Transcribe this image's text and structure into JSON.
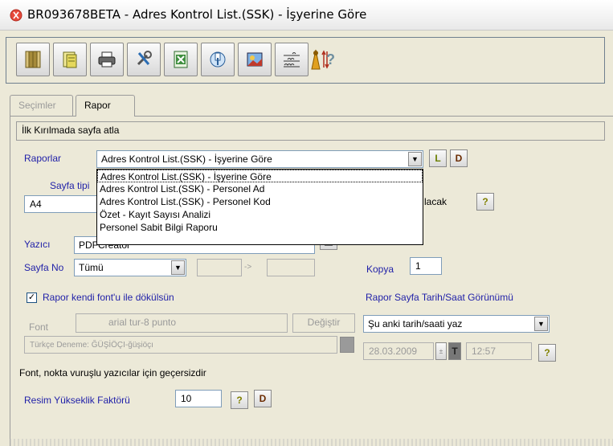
{
  "window": {
    "title": "BR093678BETA - Adres Kontrol List.(SSK) - İşyerine Göre"
  },
  "toolbar": {
    "buttons": [
      "book-icon",
      "document-icon",
      "printer-icon",
      "tools-icon",
      "excel-icon",
      "export-icon",
      "image-icon",
      "signatures-icon",
      "figure-icon",
      "sort-icon"
    ],
    "help_label": "?"
  },
  "tabs": [
    {
      "label": "Seçimler",
      "active": false
    },
    {
      "label": "Rapor",
      "active": true
    }
  ],
  "form": {
    "first_break_label": "İlk Kırılmada sayfa atla",
    "reports_label": "Raporlar",
    "reports_value": "Adres Kontrol List.(SSK) - İşyerine Göre",
    "reports_btn_l": "L",
    "reports_btn_d": "D",
    "page_type_label": "Sayfa tipi",
    "page_type_value": "A4",
    "hidden_label_tail": "lacak",
    "printer_label": "Yazıcı",
    "printer_value": "PDFCreator",
    "page_no_label": "Sayfa No",
    "page_no_value": "Tümü",
    "page_range_arrow": "->",
    "copies_label": "Kopya",
    "copies_value": "1",
    "own_font_label": "Rapor kendi font'u ile dökülsün",
    "own_font_checked": true,
    "font_label": "Font",
    "font_value": "arial tur-8 punto",
    "change_label": "Değiştir",
    "font_sample": "Türkçe Deneme: ĞÜŞİÖÇI-ğüşiöçı",
    "date_view_label": "Rapor Sayfa Tarih/Saat Görünümü",
    "date_view_value": "Şu anki tarih/saati yaz",
    "date_value": "28.03.2009",
    "date_btn": "T",
    "time_value": "12:57",
    "dot_matrix_note": "Font, nokta vuruşlu yazıcılar için geçersizdir",
    "image_height_label": "Resim Yükseklik Faktörü",
    "image_height_value": "10",
    "image_btn_d": "D",
    "help": "?"
  },
  "dropdown": {
    "items": [
      "Adres Kontrol List.(SSK) - İşyerine Göre",
      "Adres Kontrol List.(SSK) - Personel Ad",
      "Adres Kontrol List.(SSK) - Personel Kod",
      "Özet - Kayıt Sayısı Analizi",
      "Personel Sabit Bilgi Raporu"
    ],
    "selected_index": 0
  },
  "colors": {
    "accent_label": "#1f1fa8",
    "background": "#ece9d8",
    "help_icon": "#808000"
  }
}
